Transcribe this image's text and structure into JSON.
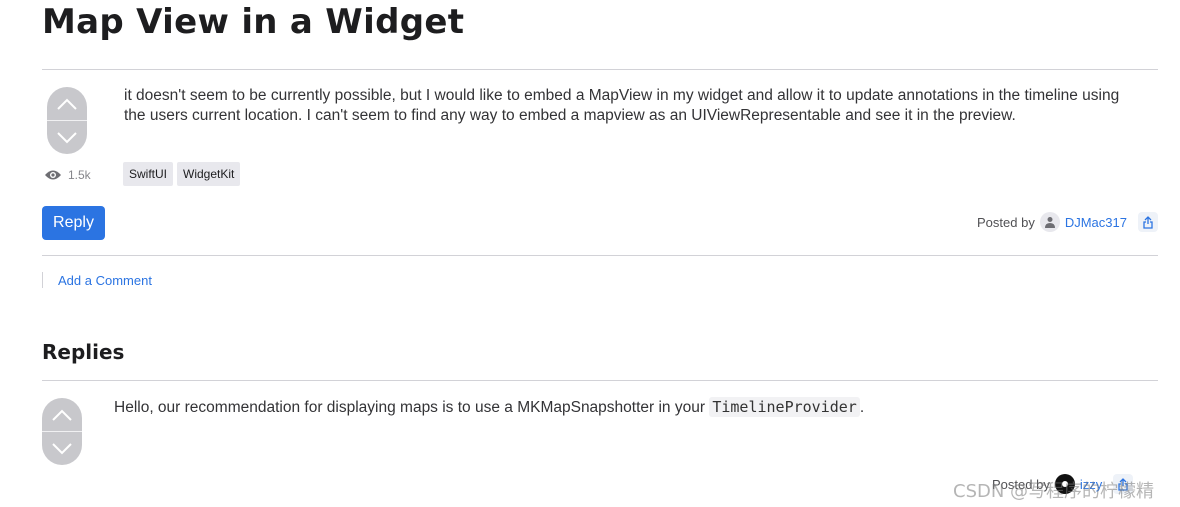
{
  "page": {
    "title": "Map View in a Widget"
  },
  "question": {
    "body": "it doesn't seem to be currently possible, but I would like to embed a MapView in my widget and allow it to update annotations in the timeline using the users current location. I can't seem to find any way to embed a mapview as an UIViewRepresentable and see it in the preview.",
    "views": "1.5k",
    "tags": [
      "SwiftUI",
      "WidgetKit"
    ],
    "reply_label": "Reply",
    "posted_by_label": "Posted by",
    "author": "DJMac317",
    "add_comment_label": "Add a Comment"
  },
  "replies": {
    "heading": "Replies",
    "items": [
      {
        "text_before": "Hello, our recommendation for displaying maps is to use a MKMapSnapshotter in your ",
        "code": "TimelineProvider",
        "text_after": ".",
        "posted_by_label": "Posted by",
        "author": "izzy"
      }
    ]
  },
  "watermark": "CSDN @写程序的柠檬精",
  "colors": {
    "accent": "#2b74e2",
    "vote_bg": "#c8c8cc",
    "tag_bg": "#e8e8ed"
  }
}
